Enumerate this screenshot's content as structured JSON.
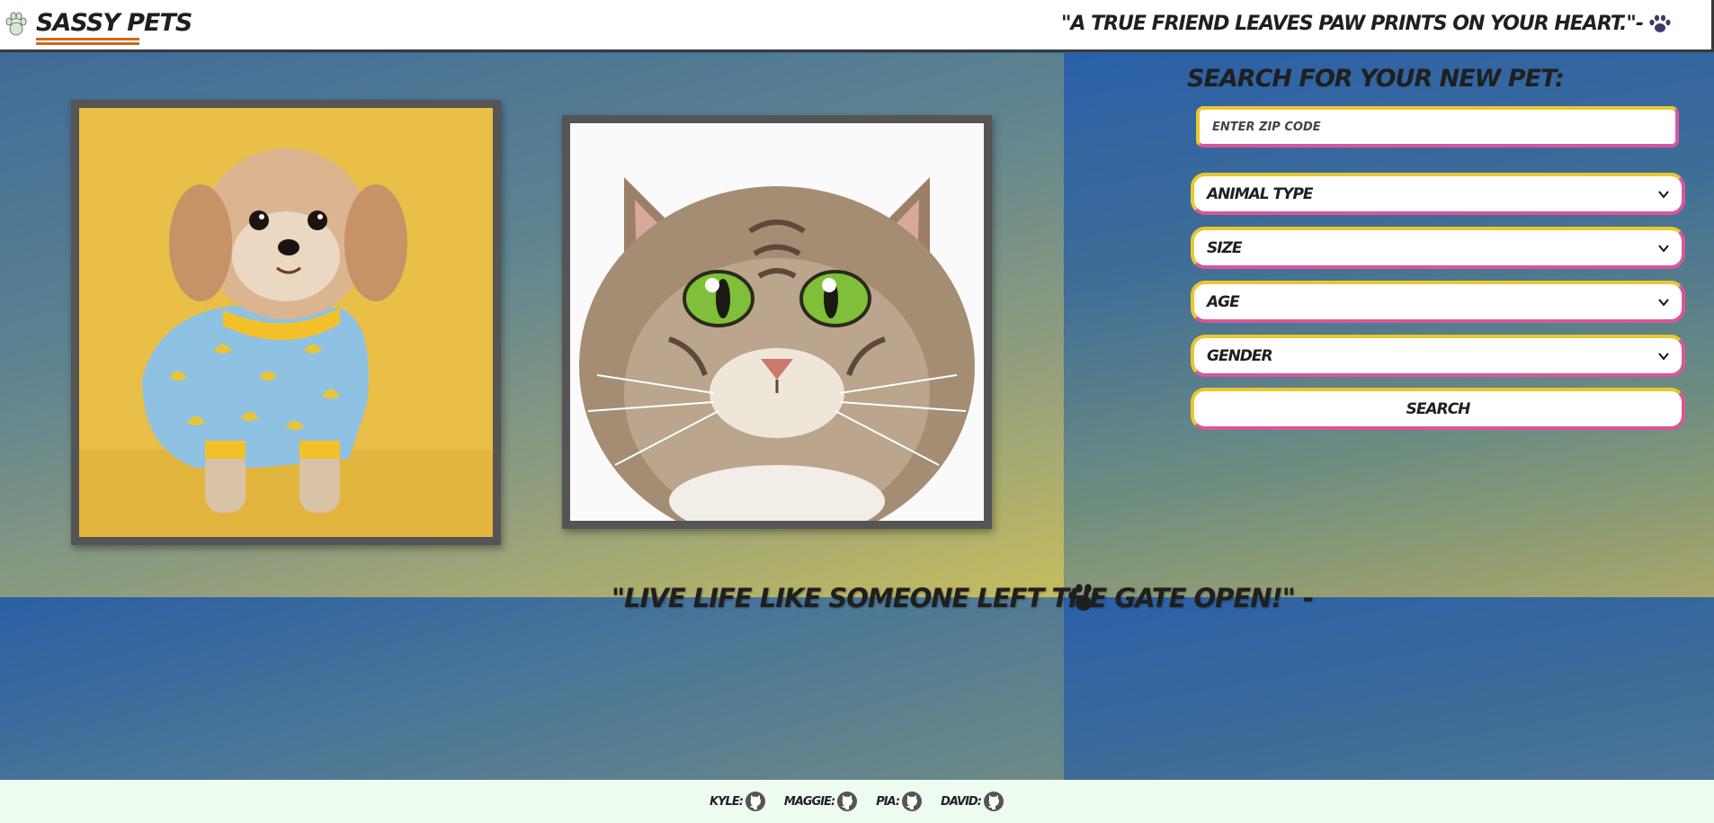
{
  "header": {
    "brand": "Sassy Pets",
    "quote": "\"A true friend leaves paw prints on your heart.\"-",
    "logo_icon": "paw-icon",
    "quote_icon": "paw-icon"
  },
  "gallery": {
    "dog_photo": "dog-photo",
    "cat_photo": "cat-photo"
  },
  "middle_quote": "\"Live life like someone left the gate open!\" -",
  "search": {
    "title": "Search for your new pet:",
    "zip_placeholder": "Enter zip code",
    "animal_type": "Animal Type",
    "size": "Size",
    "age": "Age",
    "gender": "Gender",
    "button": "Search"
  },
  "footer": {
    "authors": [
      "Kyle:",
      "Maggie:",
      "Pia:",
      "David:"
    ],
    "icon": "github-icon"
  },
  "colors": {
    "accent_yellow": "#e9c72f",
    "accent_pink": "#d9569a",
    "brand_underline": "#c96a1a",
    "footer_bg": "#eefcef"
  }
}
